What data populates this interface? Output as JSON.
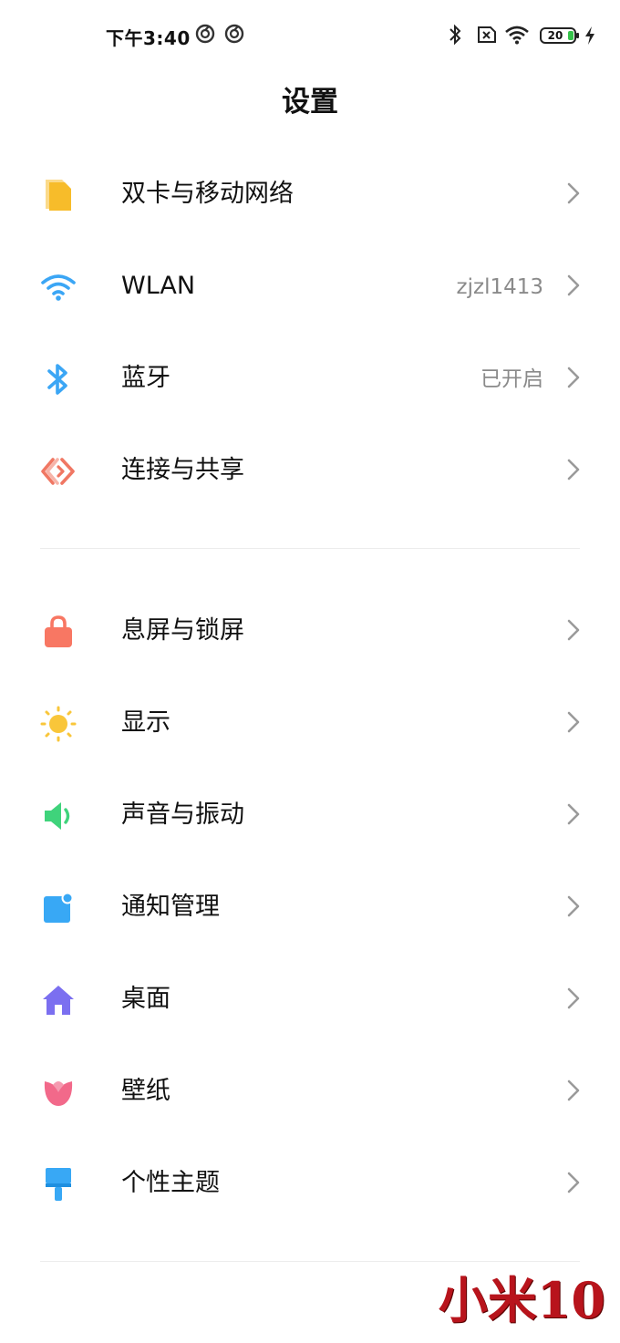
{
  "status_bar": {
    "time": "下午3:40",
    "battery_level": "20",
    "icons": [
      "notification-icon",
      "notification-icon",
      "bluetooth-icon",
      "no-sim-icon",
      "wifi-signal-icon",
      "battery-icon",
      "charging-bolt-icon"
    ]
  },
  "header": {
    "title": "设置"
  },
  "groups": [
    {
      "items": [
        {
          "label": "双卡与移动网络",
          "value": "",
          "icon": "sim-card-icon",
          "color": "#F7BC2A"
        },
        {
          "label": "WLAN",
          "value": "zjzl1413",
          "icon": "wifi-icon",
          "color": "#3BA6F5"
        },
        {
          "label": "蓝牙",
          "value": "已开启",
          "icon": "bluetooth-icon",
          "color": "#3BA6F5"
        },
        {
          "label": "连接与共享",
          "value": "",
          "icon": "connection-share-icon",
          "color": "#F07763"
        }
      ]
    },
    {
      "items": [
        {
          "label": "息屏与锁屏",
          "value": "",
          "icon": "lock-icon",
          "color": "#F87763"
        },
        {
          "label": "显示",
          "value": "",
          "icon": "sun-icon",
          "color": "#F9C63A"
        },
        {
          "label": "声音与振动",
          "value": "",
          "icon": "speaker-icon",
          "color": "#3FD37B"
        },
        {
          "label": "通知管理",
          "value": "",
          "icon": "notification-icon",
          "color": "#38A8F5"
        },
        {
          "label": "桌面",
          "value": "",
          "icon": "home-icon",
          "color": "#7B6FF0"
        },
        {
          "label": "壁纸",
          "value": "",
          "icon": "flower-icon",
          "color": "#F2698A"
        },
        {
          "label": "个性主题",
          "value": "",
          "icon": "brush-icon",
          "color": "#38A8F5"
        }
      ]
    }
  ],
  "watermark": "小米10",
  "colors": {
    "chevron": "#9a9a9a",
    "value_text": "#8a8a8a",
    "divider": "#ececec",
    "watermark": "#b8141c"
  }
}
